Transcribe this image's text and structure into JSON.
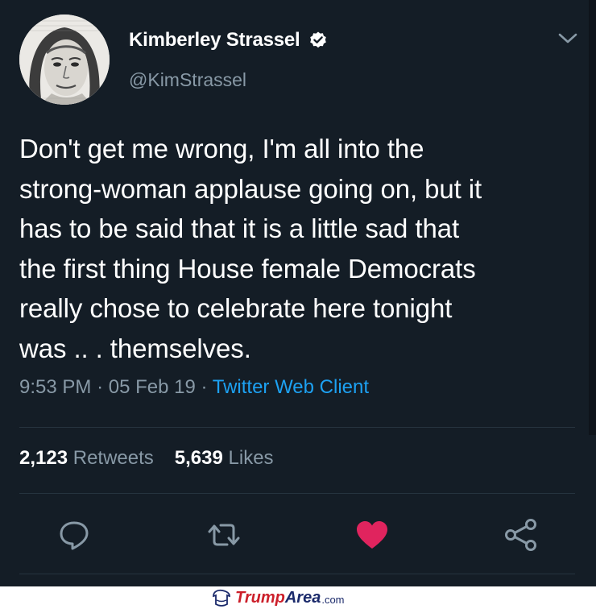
{
  "tweet": {
    "author": {
      "display_name": "Kimberley Strassel",
      "handle": "@KimStrassel",
      "verified": true
    },
    "text_lines": [
      "Don't get me wrong, I'm all into the",
      "strong-woman applause going on, but it",
      "has to be said that it is a little sad that",
      "the first thing House female Democrats",
      "really chose to celebrate here tonight",
      "was .. . themselves."
    ],
    "time": "9:53 PM",
    "date": "05 Feb 19",
    "separator": "·",
    "client": "Twitter Web Client",
    "retweets_count": "2,123",
    "retweets_label": "Retweets",
    "likes_count": "5,639",
    "likes_label": "Likes",
    "liked": true
  },
  "watermark": {
    "part1": "Trump",
    "part2": "Area",
    "part3": ".com"
  },
  "colors": {
    "background": "#141d26",
    "text": "#ffffff",
    "secondary": "#8899a6",
    "link": "#1da1f2",
    "like": "#e0245e"
  },
  "icons": {
    "verified": "verified-badge-icon",
    "more": "chevron-down-icon",
    "reply": "reply-icon",
    "retweet": "retweet-icon",
    "like": "heart-icon",
    "share": "share-icon"
  }
}
